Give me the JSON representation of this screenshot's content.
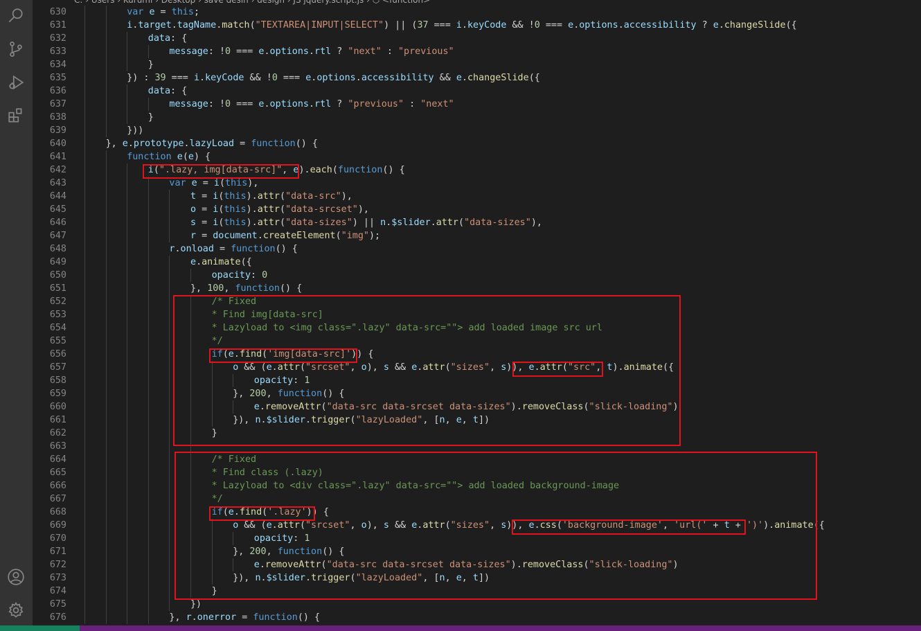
{
  "breadcrumb": {
    "text": "C: › Users › Kurumi › Desktop › save desin › design › JS jquery.script.js › ⬡ <function>"
  },
  "activity_bar": {
    "items": [
      {
        "icon": "search-icon"
      },
      {
        "icon": "source-control-icon"
      },
      {
        "icon": "run-debug-icon"
      },
      {
        "icon": "extensions-icon"
      }
    ],
    "bottom": [
      {
        "icon": "account-icon"
      },
      {
        "icon": "gear-icon"
      }
    ]
  },
  "colors": {
    "keyword": "#569cd6",
    "string": "#ce9178",
    "comment": "#6a9955",
    "number": "#b5cea8",
    "function": "#dcdcaa",
    "variable": "#9cdcfe",
    "highlight": "#e0141c",
    "status_bar": "#68217a"
  },
  "lines": [
    {
      "n": "630",
      "indent": 2,
      "code": "var e = this;"
    },
    {
      "n": "631",
      "indent": 2,
      "code": "i.target.tagName.match(\"TEXTAREA|INPUT|SELECT\") || (37 === i.keyCode && !0 === e.options.accessibility ? e.changeSlide({"
    },
    {
      "n": "632",
      "indent": 3,
      "code": "data: {"
    },
    {
      "n": "633",
      "indent": 4,
      "code": "message: !0 === e.options.rtl ? \"next\" : \"previous\""
    },
    {
      "n": "634",
      "indent": 3,
      "code": "}"
    },
    {
      "n": "635",
      "indent": 2,
      "code": "}) : 39 === i.keyCode && !0 === e.options.accessibility && e.changeSlide({"
    },
    {
      "n": "636",
      "indent": 3,
      "code": "data: {"
    },
    {
      "n": "637",
      "indent": 4,
      "code": "message: !0 === e.options.rtl ? \"previous\" : \"next\""
    },
    {
      "n": "638",
      "indent": 3,
      "code": "}"
    },
    {
      "n": "639",
      "indent": 2,
      "code": "}))"
    },
    {
      "n": "640",
      "indent": 1,
      "code": "}, e.prototype.lazyLoad = function() {"
    },
    {
      "n": "641",
      "indent": 2,
      "code": "function e(e) {"
    },
    {
      "n": "642",
      "indent": 3,
      "code": "i(\".lazy, img[data-src]\", e).each(function() {"
    },
    {
      "n": "643",
      "indent": 4,
      "code": "var e = i(this),"
    },
    {
      "n": "644",
      "indent": 5,
      "code": "t = i(this).attr(\"data-src\"),"
    },
    {
      "n": "645",
      "indent": 5,
      "code": "o = i(this).attr(\"data-srcset\"),"
    },
    {
      "n": "646",
      "indent": 5,
      "code": "s = i(this).attr(\"data-sizes\") || n.$slider.attr(\"data-sizes\"),"
    },
    {
      "n": "647",
      "indent": 5,
      "code": "r = document.createElement(\"img\");"
    },
    {
      "n": "648",
      "indent": 4,
      "code": "r.onload = function() {"
    },
    {
      "n": "649",
      "indent": 5,
      "code": "e.animate({"
    },
    {
      "n": "650",
      "indent": 6,
      "code": "opacity: 0"
    },
    {
      "n": "651",
      "indent": 5,
      "code": "}, 100, function() {"
    },
    {
      "n": "652",
      "indent": 6,
      "code": "/* Fixed"
    },
    {
      "n": "653",
      "indent": 6,
      "code": "* Find img[data-src]"
    },
    {
      "n": "654",
      "indent": 6,
      "code": "* Lazyload to <img class=\".lazy\" data-src=\"\"> add loaded image src url"
    },
    {
      "n": "655",
      "indent": 6,
      "code": "*/"
    },
    {
      "n": "656",
      "indent": 6,
      "code": "if(e.find('img[data-src]')) {"
    },
    {
      "n": "657",
      "indent": 7,
      "code": "o && (e.attr(\"srcset\", o), s && e.attr(\"sizes\", s)), e.attr(\"src\", t).animate({"
    },
    {
      "n": "658",
      "indent": 8,
      "code": "opacity: 1"
    },
    {
      "n": "659",
      "indent": 7,
      "code": "}, 200, function() {"
    },
    {
      "n": "660",
      "indent": 8,
      "code": "e.removeAttr(\"data-src data-srcset data-sizes\").removeClass(\"slick-loading\")"
    },
    {
      "n": "661",
      "indent": 7,
      "code": "}), n.$slider.trigger(\"lazyLoaded\", [n, e, t])"
    },
    {
      "n": "662",
      "indent": 6,
      "code": "}"
    },
    {
      "n": "663",
      "indent": 6,
      "code": ""
    },
    {
      "n": "664",
      "indent": 6,
      "code": "/* Fixed"
    },
    {
      "n": "665",
      "indent": 6,
      "code": "* Find class (.lazy)"
    },
    {
      "n": "666",
      "indent": 6,
      "code": "* Lazyload to <div class=\".lazy\" data-src=\"\"> add loaded background-image"
    },
    {
      "n": "667",
      "indent": 6,
      "code": "*/"
    },
    {
      "n": "668",
      "indent": 6,
      "code": "if(e.find('.lazy')) {"
    },
    {
      "n": "669",
      "indent": 7,
      "code": "o && (e.attr(\"srcset\", o), s && e.attr(\"sizes\", s)), e.css('background-image', 'url(' + t + ')').animate({"
    },
    {
      "n": "670",
      "indent": 8,
      "code": "opacity: 1"
    },
    {
      "n": "671",
      "indent": 7,
      "code": "}, 200, function() {"
    },
    {
      "n": "672",
      "indent": 8,
      "code": "e.removeAttr(\"data-src data-srcset data-sizes\").removeClass(\"slick-loading\")"
    },
    {
      "n": "673",
      "indent": 7,
      "code": "}), n.$slider.trigger(\"lazyLoaded\", [n, e, t])"
    },
    {
      "n": "674",
      "indent": 6,
      "code": "}"
    },
    {
      "n": "675",
      "indent": 5,
      "code": "})"
    },
    {
      "n": "676",
      "indent": 4,
      "code": "}, r.onerror = function() {"
    }
  ]
}
